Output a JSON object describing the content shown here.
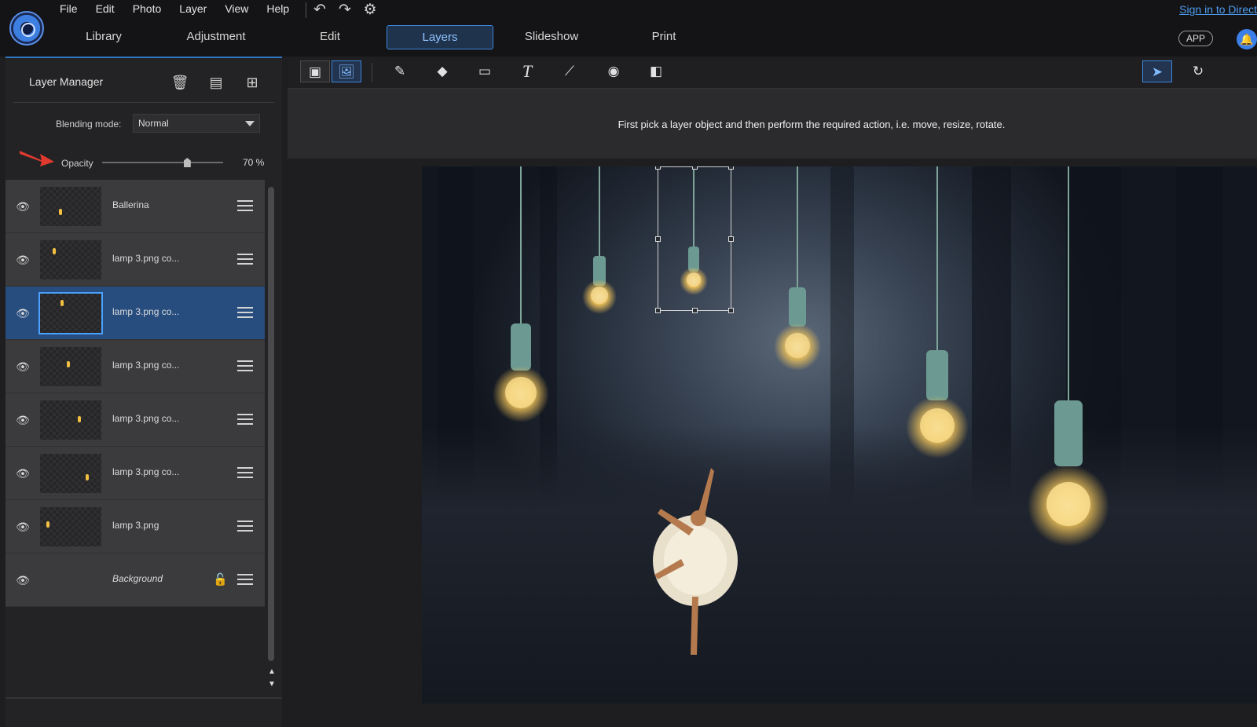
{
  "menu": [
    "File",
    "Edit",
    "Photo",
    "Layer",
    "View",
    "Help"
  ],
  "quick_actions": {
    "undo": "↶",
    "redo": "↷",
    "settings": "⚙"
  },
  "signin": "Sign in to Direct",
  "tabs": [
    {
      "label": "Library",
      "active": false
    },
    {
      "label": "Adjustment",
      "active": false
    },
    {
      "label": "Edit",
      "active": false
    },
    {
      "label": "Layers",
      "active": true
    },
    {
      "label": "Slideshow",
      "active": false
    },
    {
      "label": "Print",
      "active": false
    }
  ],
  "app_badge": "APP",
  "panel": {
    "title": "Layer Manager",
    "blending_label": "Blending mode:",
    "blending_value": "Normal",
    "opacity_label": "Opacity",
    "opacity_value": 70,
    "opacity_text": "70 %",
    "layers": [
      {
        "name": "Ballerina",
        "selected": false,
        "locked": false,
        "italic": false
      },
      {
        "name": "lamp 3.png co...",
        "selected": false,
        "locked": false,
        "italic": false
      },
      {
        "name": "lamp 3.png co...",
        "selected": true,
        "locked": false,
        "italic": false
      },
      {
        "name": "lamp 3.png co...",
        "selected": false,
        "locked": false,
        "italic": false
      },
      {
        "name": "lamp 3.png co...",
        "selected": false,
        "locked": false,
        "italic": false
      },
      {
        "name": "lamp 3.png co...",
        "selected": false,
        "locked": false,
        "italic": false
      },
      {
        "name": "lamp 3.png",
        "selected": false,
        "locked": false,
        "italic": false
      },
      {
        "name": "Background",
        "selected": false,
        "locked": true,
        "italic": true
      }
    ]
  },
  "tools": [
    "layer-image-tool",
    "photo-tool",
    "pencil",
    "eraser",
    "rectangle",
    "text",
    "brush",
    "fill",
    "gradient",
    "select",
    "rotate"
  ],
  "hint": "First pick a layer object and then perform the required action, i.e. move, resize, rotate.",
  "colors": {
    "accent": "#3d86d8",
    "selected_layer": "#274d7f",
    "link": "#4d9cf0"
  }
}
